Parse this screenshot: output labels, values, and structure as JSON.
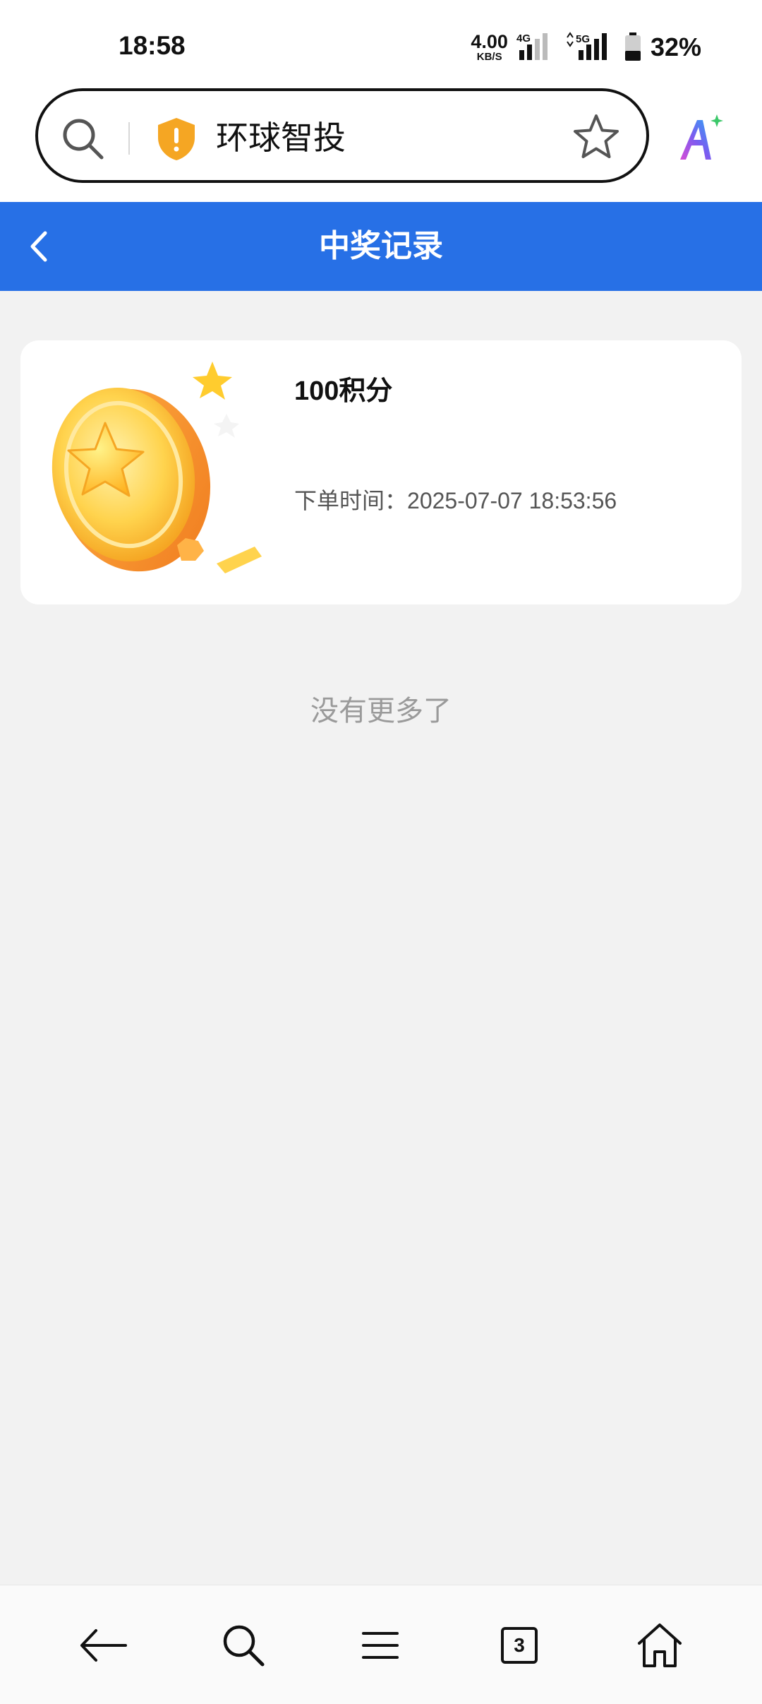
{
  "status_bar": {
    "time": "18:58",
    "net_speed_value": "4.00",
    "net_speed_unit": "KB/S",
    "network_1": "4G",
    "network_2": "5G",
    "battery": "32%"
  },
  "browser": {
    "address_text": "环球智投",
    "icons": [
      "search-icon",
      "shield-warning-icon",
      "star-icon",
      "ai-assistant-icon"
    ],
    "accent_shield": "#f5a623"
  },
  "header": {
    "title": "中奖记录",
    "color": "#2770e6"
  },
  "records": [
    {
      "prize": "100积分",
      "order_time_label": "下单时间：",
      "order_time_value": "2025-07-07 18:53:56"
    }
  ],
  "footer_note": "没有更多了",
  "bottom_nav": {
    "tab_count": "3",
    "icons": [
      "back-arrow-icon",
      "search-icon",
      "menu-icon",
      "tabs-icon",
      "home-icon"
    ]
  }
}
